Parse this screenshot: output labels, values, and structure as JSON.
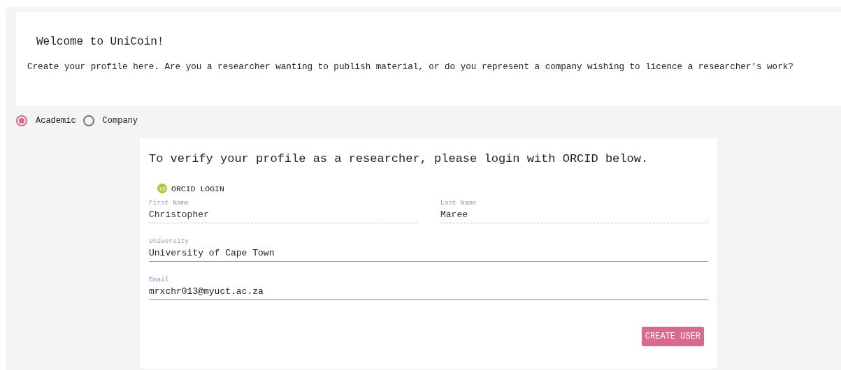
{
  "intro": {
    "title": "Welcome to UniCoin!",
    "text": "Create your profile here. Are you a researcher wanting to publish material, or do you represent a company wishing to licence a researcher's work?"
  },
  "account_types": [
    {
      "label": "Academic",
      "selected": true
    },
    {
      "label": "Company",
      "selected": false
    }
  ],
  "form": {
    "heading": "To verify your profile as a researcher, please login with ORCID below.",
    "orcid_button": "ORCID LOGIN",
    "orcid_icon": "iD",
    "fields": [
      {
        "label": "First Name",
        "value": "Christopher",
        "disabled": true,
        "focused": false
      },
      {
        "label": "Last Name",
        "value": "Maree",
        "disabled": true,
        "focused": false
      },
      {
        "label": "University",
        "value": "University of Cape Town",
        "disabled": false,
        "focused": false
      },
      {
        "label": "Email",
        "value": "mrxchr013@myuct.ac.za",
        "disabled": false,
        "focused": true
      }
    ],
    "submit": "CREATE USER"
  }
}
